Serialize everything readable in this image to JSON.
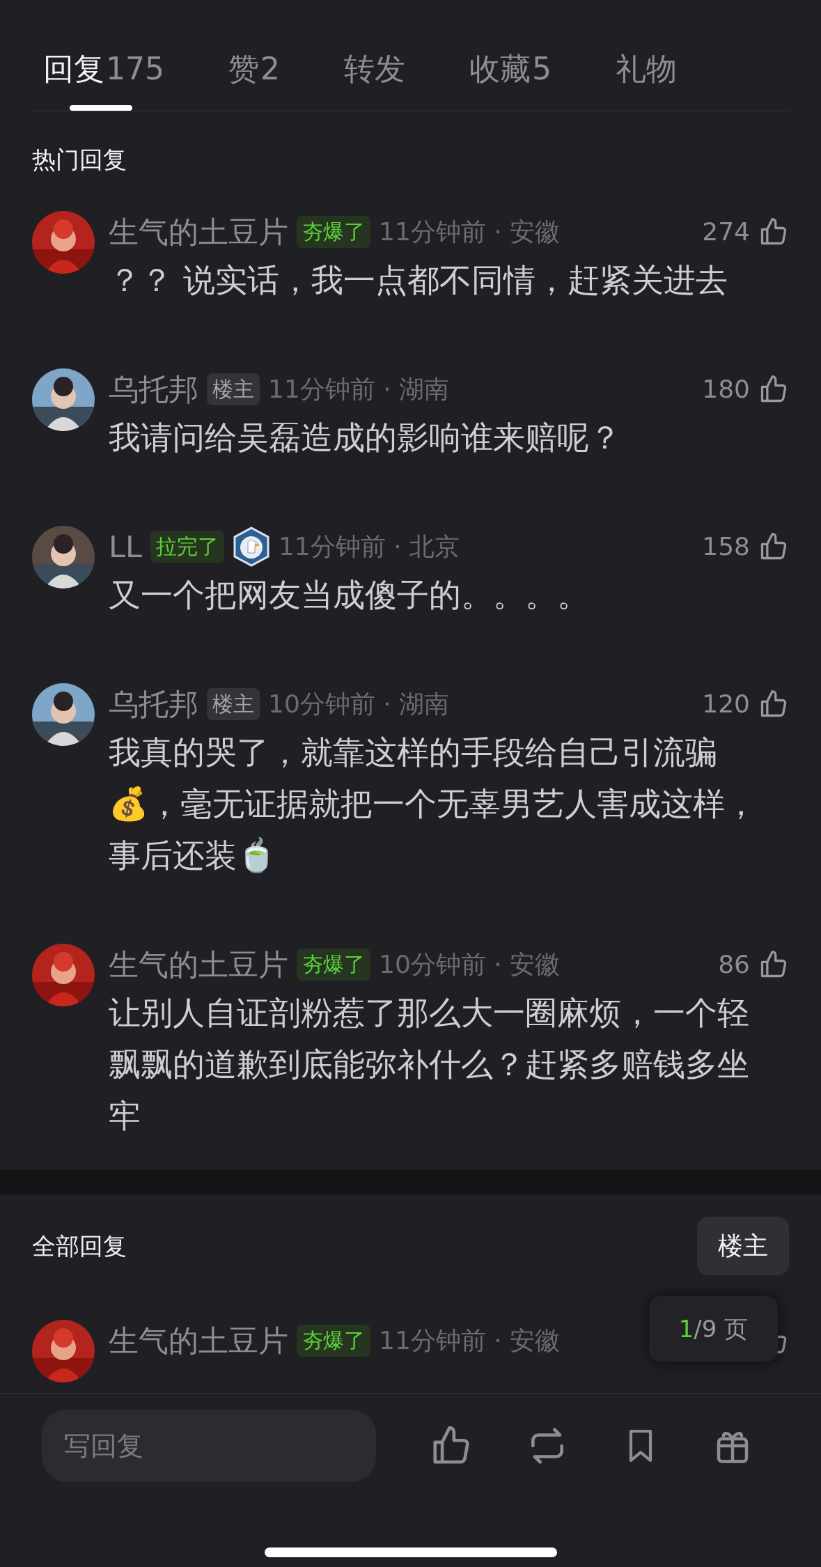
{
  "tabs": [
    {
      "label": "回复",
      "count": "175",
      "selected": true
    },
    {
      "label": "赞",
      "count": "2",
      "selected": false
    },
    {
      "label": "转发",
      "selected": false
    },
    {
      "label": "收藏",
      "count": "5",
      "selected": false
    },
    {
      "label": "礼物",
      "selected": false
    }
  ],
  "hot_section": {
    "title": "热门回复",
    "comments": [
      {
        "name": "生气的土豆片",
        "tag": {
          "text": "夯爆了",
          "kind": "award"
        },
        "meta": "11分钟前 · 安徽",
        "likes": "274",
        "text": "？？ 说实话，我一点都不同情，赶紧关进去"
      },
      {
        "name": "乌托邦",
        "tag": {
          "text": "楼主",
          "kind": "op"
        },
        "meta": "11分钟前 · 湖南",
        "likes": "180",
        "text": "我请问给吴磊造成的影响谁来赔呢？"
      },
      {
        "name": "LL",
        "tag": {
          "text": "拉完了",
          "kind": "award"
        },
        "medal": true,
        "meta": "11分钟前 · 北京",
        "likes": "158",
        "text": "又一个把网友当成傻子的。。。。"
      },
      {
        "name": "乌托邦",
        "tag": {
          "text": "楼主",
          "kind": "op"
        },
        "meta": "10分钟前 · 湖南",
        "likes": "120",
        "text": "我真的哭了，就靠这样的手段给自己引流骗💰，毫无证据就把一个无辜男艺人害成这样，事后还装🍵"
      },
      {
        "name": "生气的土豆片",
        "tag": {
          "text": "夯爆了",
          "kind": "award"
        },
        "meta": "10分钟前 · 安徽",
        "likes": "86",
        "text": "让别人自证剖粉惹了那么大一圈麻烦，一个轻飘飘的道歉到底能弥补什么？赶紧多赔钱多坐牢"
      }
    ]
  },
  "all_section": {
    "title": "全部回复",
    "filter_button": "楼主",
    "page_indicator": {
      "current": "1",
      "rest": "/9 页"
    },
    "comments": [
      {
        "name": "生气的土豆片",
        "tag": {
          "text": "夯爆了",
          "kind": "award"
        },
        "meta": "11分钟前 · 安徽"
      }
    ]
  },
  "reply_bar": {
    "placeholder": "写回复"
  }
}
